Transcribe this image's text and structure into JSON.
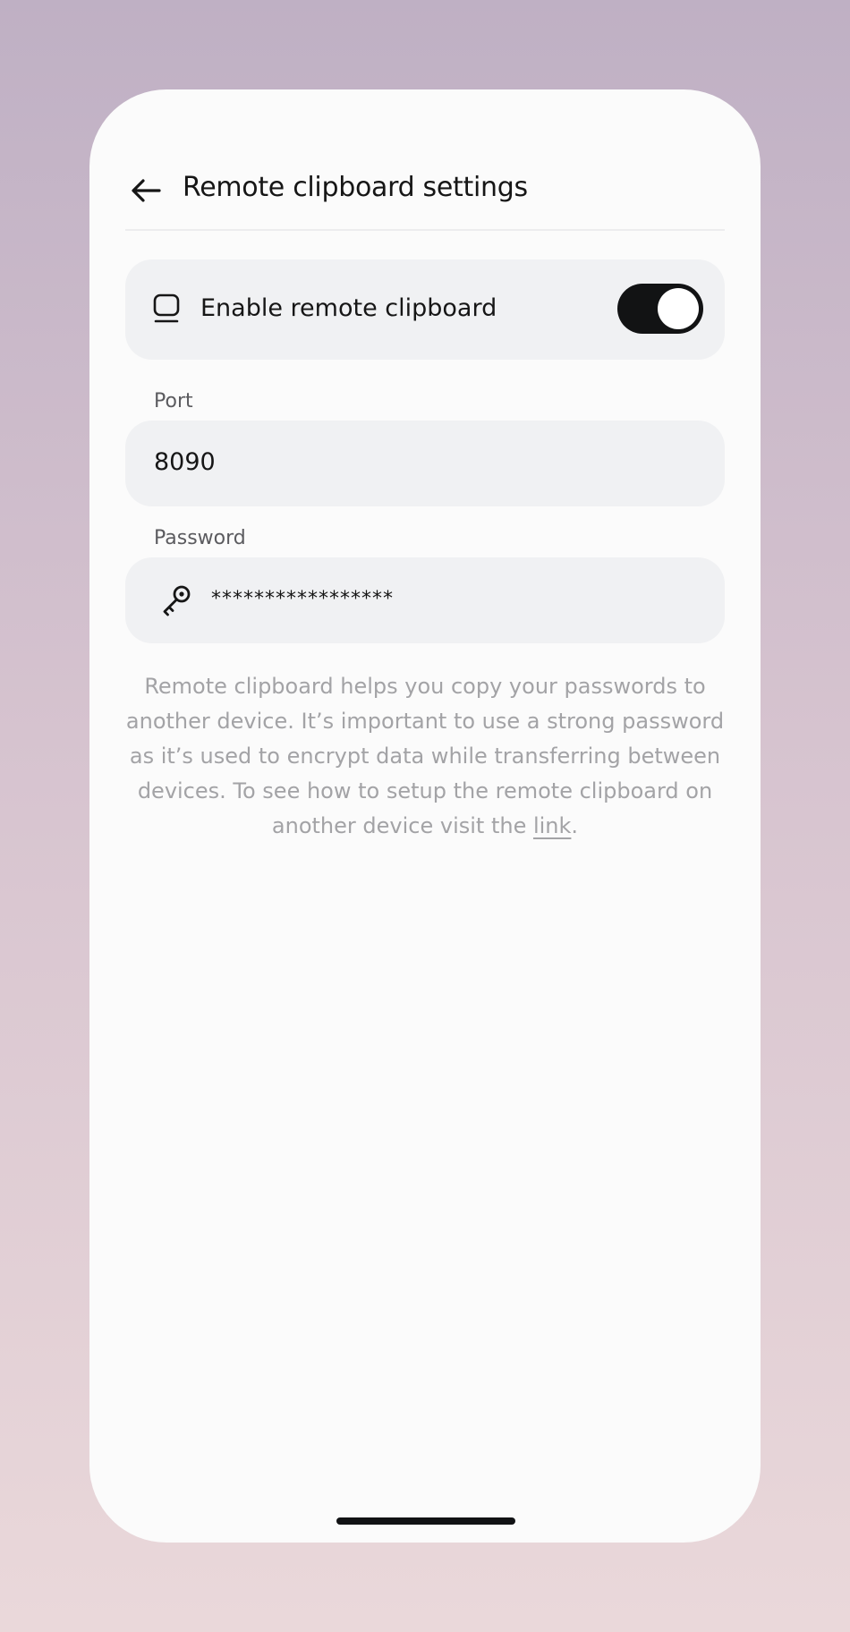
{
  "header": {
    "title": "Remote clipboard settings",
    "back_icon": "arrow-left-icon"
  },
  "remote_clipboard": {
    "icon": "clipboard-icon",
    "label": "Enable remote clipboard",
    "enabled": true
  },
  "port": {
    "label": "Port",
    "value": "8090"
  },
  "password": {
    "label": "Password",
    "icon": "key-icon",
    "value": "*****************"
  },
  "help": {
    "text": "Remote clipboard helps you copy your passwords to another device. It’s important to use a strong password as it’s used to encrypt data while transferring between devices. To see how to setup the remote clipboard on another device visit the ",
    "link_label": "link",
    "suffix": "."
  },
  "colors": {
    "toggle_on": "#121314",
    "card_background": "#f0f1f3",
    "help_text": "#a3a3a6"
  }
}
